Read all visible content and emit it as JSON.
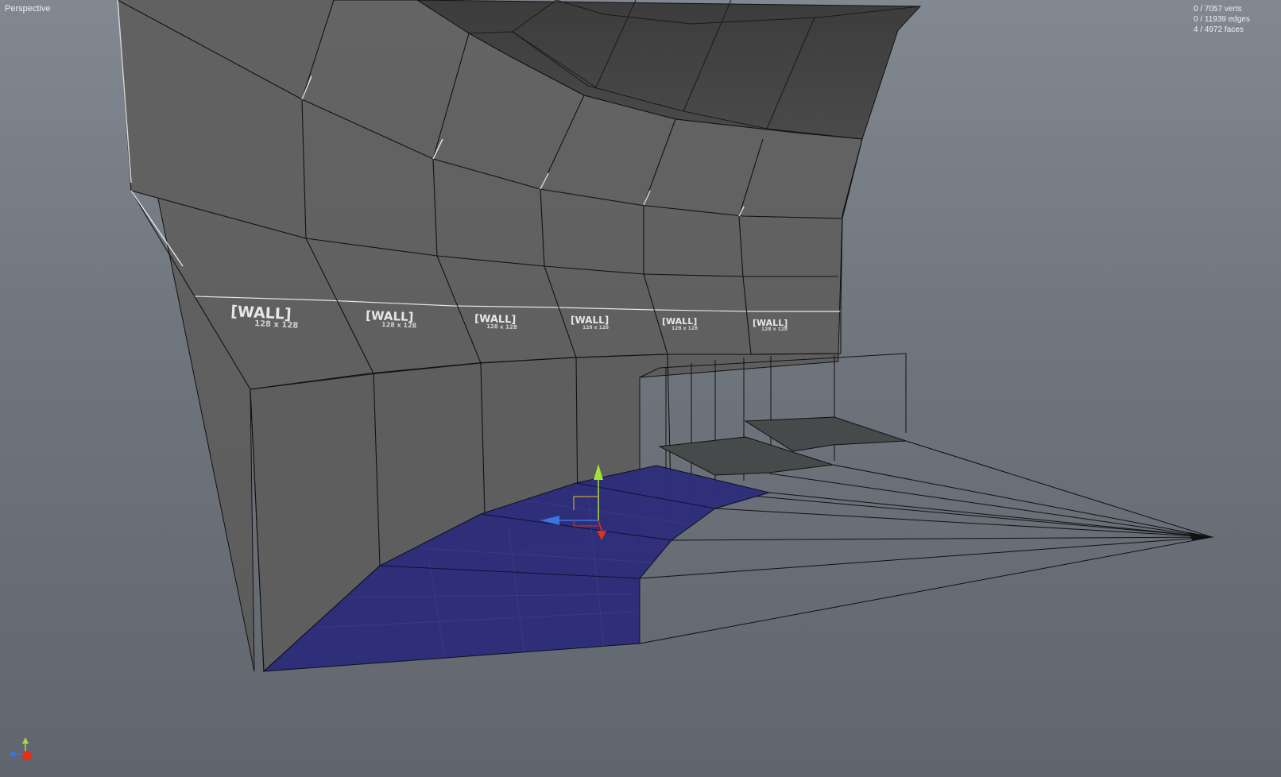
{
  "viewport": {
    "label": "Perspective",
    "stats": {
      "verts": "0 / 7057 verts",
      "edges": "0 / 11939 edges",
      "faces": "4 / 4972 faces"
    }
  },
  "texture": {
    "label": "[WALL]",
    "size": "128 x 128"
  },
  "colors": {
    "selected_face": "#2e2e7a",
    "wall_face": "#5f5f5f",
    "ceiling_face": "#444444",
    "gizmo_x": "#e0301c",
    "gizmo_y": "#a8e03a",
    "gizmo_z": "#3c74e0"
  },
  "icons": {
    "move_gizmo": "move-gizmo-icon",
    "axis_indicator": "axis-indicator-icon"
  }
}
